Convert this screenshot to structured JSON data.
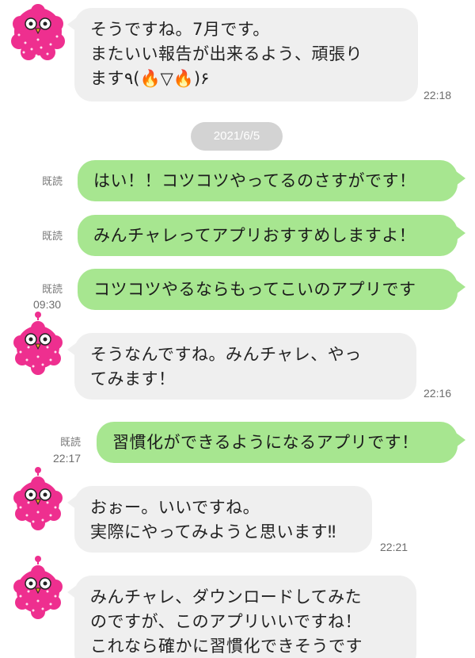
{
  "colors": {
    "incoming_bubble": "#efefef",
    "outgoing_bubble": "#a7e690",
    "date_pill": "#d3d3d3",
    "avatar_pink": "#ee2f8f"
  },
  "date_separator": "2021/6/5",
  "read_label": "既読",
  "messages": [
    {
      "direction": "incoming",
      "avatar": "pink-owl-icon",
      "text": "そうですね。7月です。\nまたいい報告が出来るよう、頑張り\nます٩(🔥▽🔥)۶",
      "time": "22:18"
    },
    {
      "direction": "outgoing",
      "text": "はい！！コツコツやってるのさすがです！",
      "read": "既読",
      "time": ""
    },
    {
      "direction": "outgoing",
      "text": "みんチャレってアプリおすすめしますよ！",
      "read": "既読",
      "time": ""
    },
    {
      "direction": "outgoing",
      "text": "コツコツやるならもってこいのアプリです",
      "read": "既読",
      "time": "09:30"
    },
    {
      "direction": "incoming",
      "avatar": "pink-owl-icon",
      "text": "そうなんですね。みんチャレ、やっ\nてみます！",
      "time": "22:16"
    },
    {
      "direction": "outgoing",
      "text": "習慣化ができるようになるアプリです！",
      "read": "既読",
      "time": "22:17"
    },
    {
      "direction": "incoming",
      "avatar": "pink-owl-icon",
      "text": "おぉー。いいですね。\n実際にやってみようと思います‼︎",
      "time": "22:21"
    },
    {
      "direction": "incoming",
      "avatar": "pink-owl-icon",
      "text": "みんチャレ、ダウンロードしてみた\nのですが、このアプリいいですね！\nこれなら確かに習慣化できそうです",
      "time": ""
    }
  ]
}
